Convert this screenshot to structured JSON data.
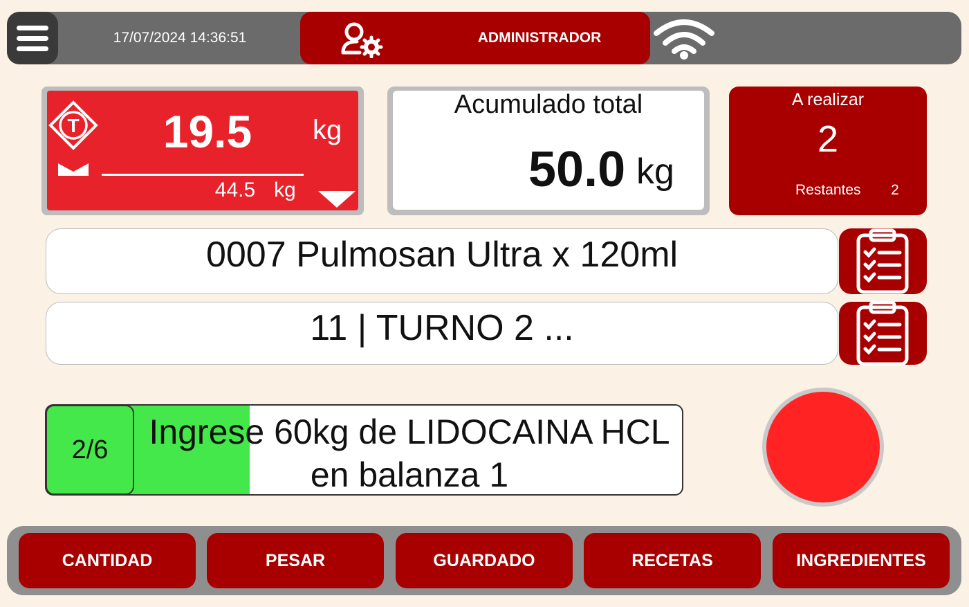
{
  "header": {
    "datetime": "17/07/2024 14:36:51",
    "user_role": "ADMINISTRADOR",
    "menu_icon": "hamburger-menu-icon",
    "user_icon": "user-settings-icon",
    "wifi_icon": "wifi-icon"
  },
  "scale": {
    "weight": "19.5",
    "weight_unit": "kg",
    "secondary_weight": "44.5",
    "secondary_unit": "kg",
    "tare_icon": "tare-icon",
    "zero_icon": "zero-icon",
    "dropdown_icon": "triangle-down-icon",
    "color": "#e8222b"
  },
  "accumulated": {
    "title": "Acumulado total",
    "value": "50.0",
    "unit": "kg"
  },
  "pending": {
    "title": "A realizar",
    "value": "2",
    "remaining_label": "Restantes",
    "remaining_value": "2"
  },
  "product": {
    "label": "0007 Pulmosan Ultra x 120ml",
    "list_icon": "clipboard-checklist-icon"
  },
  "batch": {
    "label": "11 | TURNO 2 ...",
    "list_icon": "clipboard-checklist-icon"
  },
  "instruction": {
    "step": "2/6",
    "line1": "Ingrese 60kg de LIDOCAINA HCL",
    "line2": "en balanza 1",
    "progress_fraction": 0.32,
    "progress_color": "#44e84a"
  },
  "status": {
    "color": "#ff2323"
  },
  "nav": {
    "buttons": [
      {
        "label": "CANTIDAD"
      },
      {
        "label": "PESAR"
      },
      {
        "label": "GUARDADO"
      },
      {
        "label": "RECETAS"
      },
      {
        "label": "INGREDIENTES"
      }
    ]
  },
  "colors": {
    "brand_red": "#a80000",
    "background": "#fbf1e4"
  }
}
